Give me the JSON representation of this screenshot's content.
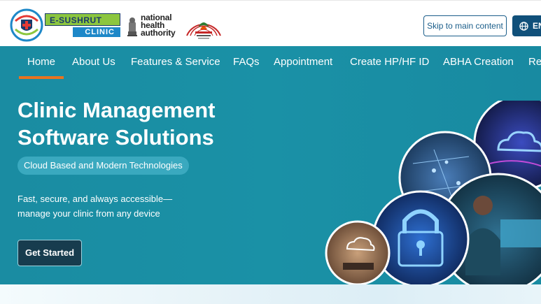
{
  "header": {
    "logo_esushrut_top": "E-SUSHRUT",
    "logo_esushrut_bottom": "CLINIC",
    "logo_nha_text": [
      "national",
      "health",
      "authority"
    ],
    "skip_link": "Skip to main content",
    "language_button": "EN",
    "icons": [
      "esushrut-logo",
      "national-emblem",
      "abdm-logo",
      "globe-icon"
    ]
  },
  "nav": {
    "items": [
      "Home",
      "About Us",
      "Features & Service",
      "FAQs",
      "Appointment",
      "Create HP/HF ID",
      "ABHA Creation",
      "Re"
    ],
    "active": "Home",
    "active_color": "#e8731f"
  },
  "hero": {
    "title_line1": "Clinic Management",
    "title_line2": "Software Solutions",
    "pill": "Cloud Based and Modern Technologies",
    "description_line1": "Fast, secure, and always accessible—",
    "description_line2": "manage your clinic from any device",
    "cta": "Get Started",
    "images": [
      "cloud-laptop-image",
      "cloud-network-image",
      "padlock-image",
      "person-computer-image",
      "cloud-glow-image"
    ],
    "background_color": "#1a8ca2"
  }
}
